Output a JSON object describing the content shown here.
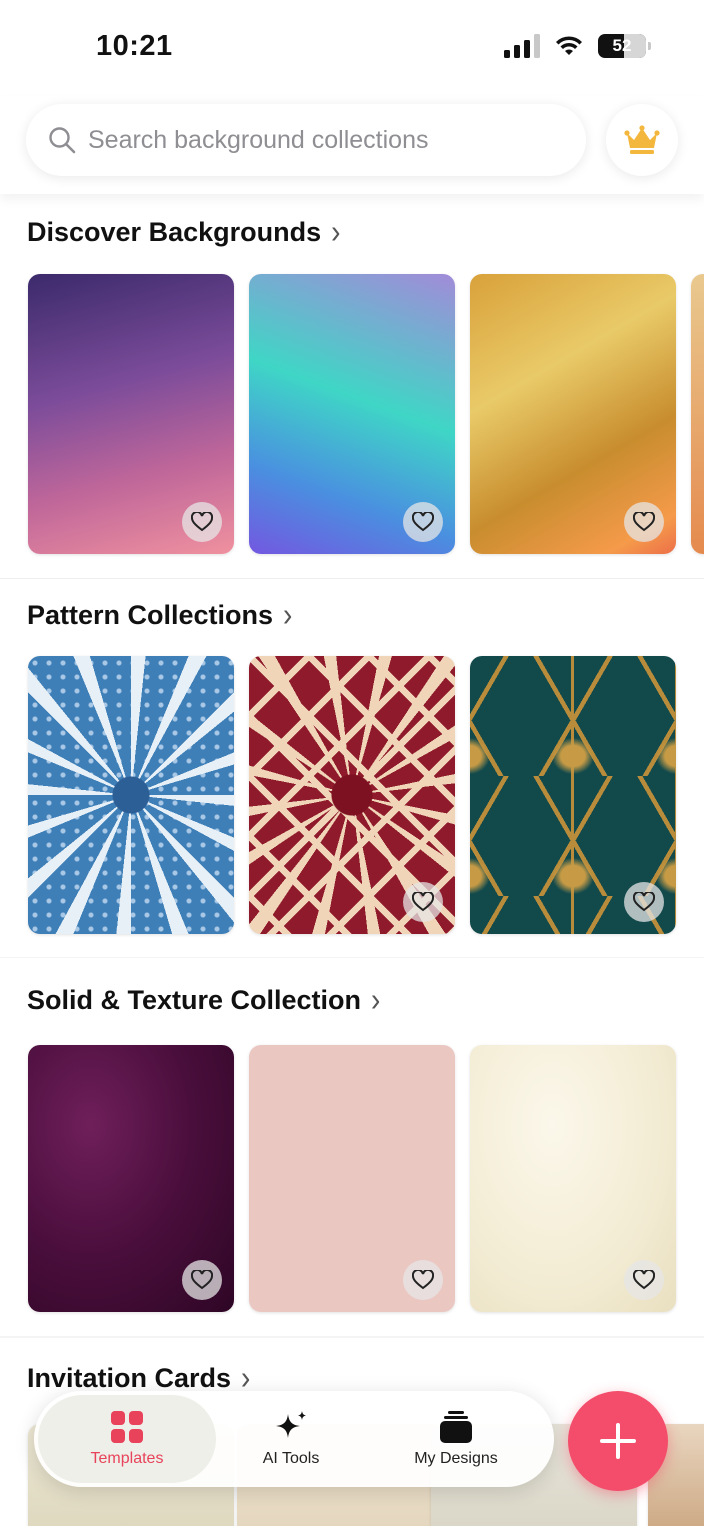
{
  "status": {
    "time": "10:21",
    "battery": "52"
  },
  "search": {
    "placeholder": "Search background collections"
  },
  "sections": [
    {
      "title": "Discover Backgrounds",
      "items": [
        "purple-pink-gradient",
        "blue-teal-gradient",
        "gold-orange-gradient"
      ]
    },
    {
      "title": "Pattern Collections",
      "items": [
        "blue-geometric-pattern",
        "red-star-pattern",
        "green-hexagon-damask"
      ]
    },
    {
      "title": "Solid & Texture Collection",
      "items": [
        "plum-damask-fabric",
        "blush-pink-solid",
        "cream-texture"
      ]
    },
    {
      "title": "Invitation Cards",
      "items": [
        "invitation-card-1",
        "invitation-card-2",
        "invitation-card-3"
      ]
    }
  ],
  "tabs": [
    {
      "label": "Templates",
      "icon": "grid-icon",
      "active": true
    },
    {
      "label": "AI Tools",
      "icon": "sparkle-icon",
      "active": false
    },
    {
      "label": "My Designs",
      "icon": "layers-icon",
      "active": false
    }
  ],
  "colors": {
    "accent": "#e8435a",
    "fab": "#f34d6b",
    "crown": "#f4b73e"
  }
}
